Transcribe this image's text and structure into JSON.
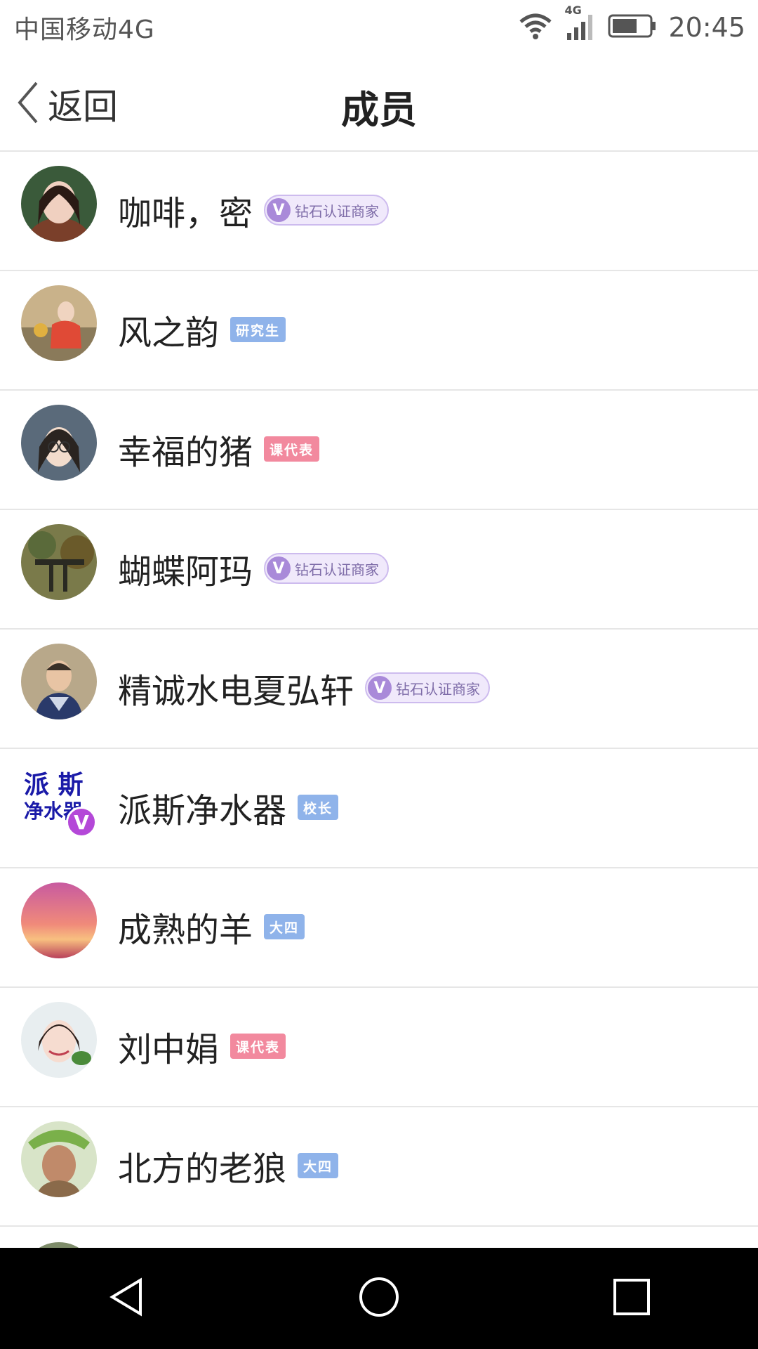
{
  "status_bar": {
    "carrier": "中国移动4G",
    "network_badge": "4G",
    "time": "20:45",
    "icons": [
      "wifi-icon",
      "signal-icon",
      "battery-icon"
    ]
  },
  "header": {
    "back_label": "返回",
    "title": "成员"
  },
  "members": [
    {
      "name": "咖啡，密",
      "tag": "钻石认证商家",
      "tag_type": "verified"
    },
    {
      "name": "风之韵",
      "tag": "研究生",
      "tag_type": "blue"
    },
    {
      "name": "幸福的猪",
      "tag": "课代表",
      "tag_type": "pink"
    },
    {
      "name": "蝴蝶阿玛",
      "tag": "钻石认证商家",
      "tag_type": "verified"
    },
    {
      "name": "精诚水电夏弘轩",
      "tag": "钻石认证商家",
      "tag_type": "verified"
    },
    {
      "name": "派斯净水器",
      "tag": "校长",
      "tag_type": "blue"
    },
    {
      "name": "成熟的羊",
      "tag": "大四",
      "tag_type": "blue"
    },
    {
      "name": "刘中娟",
      "tag": "课代表",
      "tag_type": "pink"
    },
    {
      "name": "北方的老狼",
      "tag": "大四",
      "tag_type": "blue"
    }
  ],
  "avatar_texts": {
    "paisi_line1": "派 斯",
    "paisi_line2": "净水器"
  },
  "verified_badge_letter": "V",
  "colors": {
    "tag_blue": "#8fb3ea",
    "tag_pink": "#f2899e",
    "verified_purple": "#a98ad9",
    "nav_bar": "#000000"
  },
  "nav": [
    "back-icon",
    "home-icon",
    "recents-icon"
  ]
}
